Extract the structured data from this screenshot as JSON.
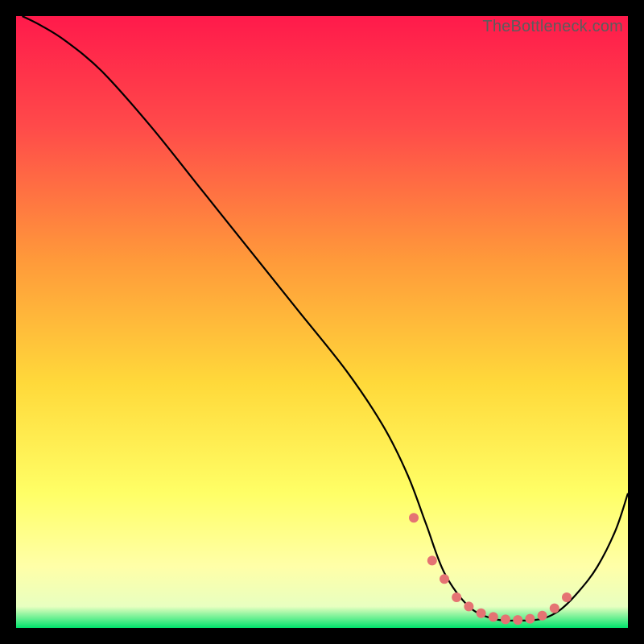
{
  "watermark": "TheBottleneck.com",
  "chart_data": {
    "type": "line",
    "title": "",
    "xlabel": "",
    "ylabel": "",
    "xlim": [
      0,
      100
    ],
    "ylim": [
      0,
      100
    ],
    "background_gradient": {
      "stops": [
        {
          "offset": 0.0,
          "color": "#ff1a4b"
        },
        {
          "offset": 0.18,
          "color": "#ff4a4a"
        },
        {
          "offset": 0.4,
          "color": "#ff9a3a"
        },
        {
          "offset": 0.6,
          "color": "#ffd93a"
        },
        {
          "offset": 0.78,
          "color": "#ffff66"
        },
        {
          "offset": 0.9,
          "color": "#ffffa8"
        },
        {
          "offset": 0.965,
          "color": "#e8ffc0"
        },
        {
          "offset": 1.0,
          "color": "#00e36b"
        }
      ]
    },
    "series": [
      {
        "name": "bottleneck-curve",
        "color": "#000000",
        "x": [
          1,
          4,
          8,
          14,
          22,
          30,
          38,
          46,
          54,
          60,
          64,
          67,
          70,
          74,
          78,
          82,
          86,
          89,
          92,
          95,
          98,
          100
        ],
        "y": [
          100,
          98.5,
          96,
          91,
          82,
          72,
          62,
          52,
          42,
          33,
          25,
          17,
          9,
          3.5,
          1.5,
          1.2,
          1.5,
          3,
          6,
          10,
          16,
          22
        ]
      }
    ],
    "markers": {
      "name": "highlight-points",
      "color": "#e57373",
      "radius": 6,
      "x": [
        65,
        68,
        70,
        72,
        74,
        76,
        78,
        80,
        82,
        84,
        86,
        88,
        90
      ],
      "y": [
        18,
        11,
        8,
        5,
        3.5,
        2.4,
        1.8,
        1.4,
        1.3,
        1.5,
        2,
        3.2,
        5
      ]
    }
  }
}
